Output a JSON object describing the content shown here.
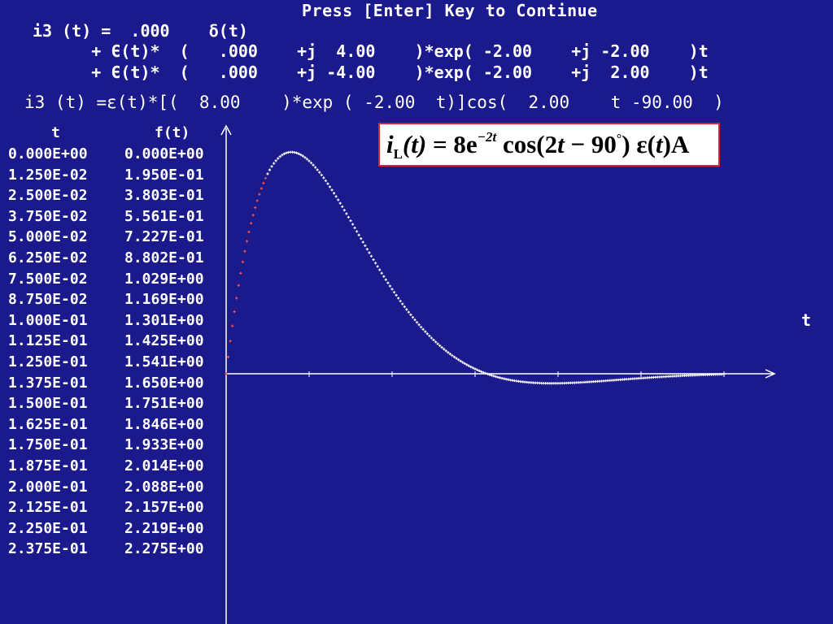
{
  "header": {
    "prompt": "Press [Enter] Key to Continue"
  },
  "solution_lines": [
    "i3 (t) =  .000    δ(t)",
    "      + Є(t)*  (   .000    +j  4.00    )*exp( -2.00    +j -2.00    )t",
    "      + Є(t)*  (   .000    +j -4.00    )*exp( -2.00    +j  2.00    )t"
  ],
  "summary_line": "i3 (t) =ε(t)*[(  8.00    )*exp ( -2.00  t)]cos(  2.00    t -90.00  )",
  "formula": {
    "i": "i",
    "sub": "L",
    "t1": "(t)",
    "eq": " = 8e",
    "exp": "−2t",
    "cos": " cos(2",
    "t2": "t",
    "minus": " − 90",
    "deg": "°",
    "close": ") ε(",
    "t3": "t",
    "unit": ")A"
  },
  "axis_label_t": "t",
  "colors": {
    "background": "#1a1a8c",
    "text": "#ffffff",
    "curve_early": "#ff5040",
    "curve": "#ffffff",
    "formula_border": "#e0202a"
  },
  "chart_data": {
    "type": "table",
    "columns": [
      "t",
      "f(t)"
    ],
    "rows": [
      [
        "0.000E+00",
        "0.000E+00"
      ],
      [
        "1.250E-02",
        "1.950E-01"
      ],
      [
        "2.500E-02",
        "3.803E-01"
      ],
      [
        "3.750E-02",
        "5.561E-01"
      ],
      [
        "5.000E-02",
        "7.227E-01"
      ],
      [
        "6.250E-02",
        "8.802E-01"
      ],
      [
        "7.500E-02",
        "1.029E+00"
      ],
      [
        "8.750E-02",
        "1.169E+00"
      ],
      [
        "1.000E-01",
        "1.301E+00"
      ],
      [
        "1.125E-01",
        "1.425E+00"
      ],
      [
        "1.250E-01",
        "1.541E+00"
      ],
      [
        "1.375E-01",
        "1.650E+00"
      ],
      [
        "1.500E-01",
        "1.751E+00"
      ],
      [
        "1.625E-01",
        "1.846E+00"
      ],
      [
        "1.750E-01",
        "1.933E+00"
      ],
      [
        "1.875E-01",
        "2.014E+00"
      ],
      [
        "2.000E-01",
        "2.088E+00"
      ],
      [
        "2.125E-01",
        "2.157E+00"
      ],
      [
        "2.250E-01",
        "2.219E+00"
      ],
      [
        "2.375E-01",
        "2.275E+00"
      ]
    ],
    "plot": {
      "type": "scatter",
      "function": "8*exp(-2t)*cos(2t-90deg)",
      "amplitude": 8,
      "decay": 2,
      "omega": 2,
      "phase_deg": -90,
      "xlim": [
        0,
        3
      ],
      "ylim": [
        0,
        2.6
      ],
      "tabulated_until": 0.2375,
      "grid": false
    }
  }
}
